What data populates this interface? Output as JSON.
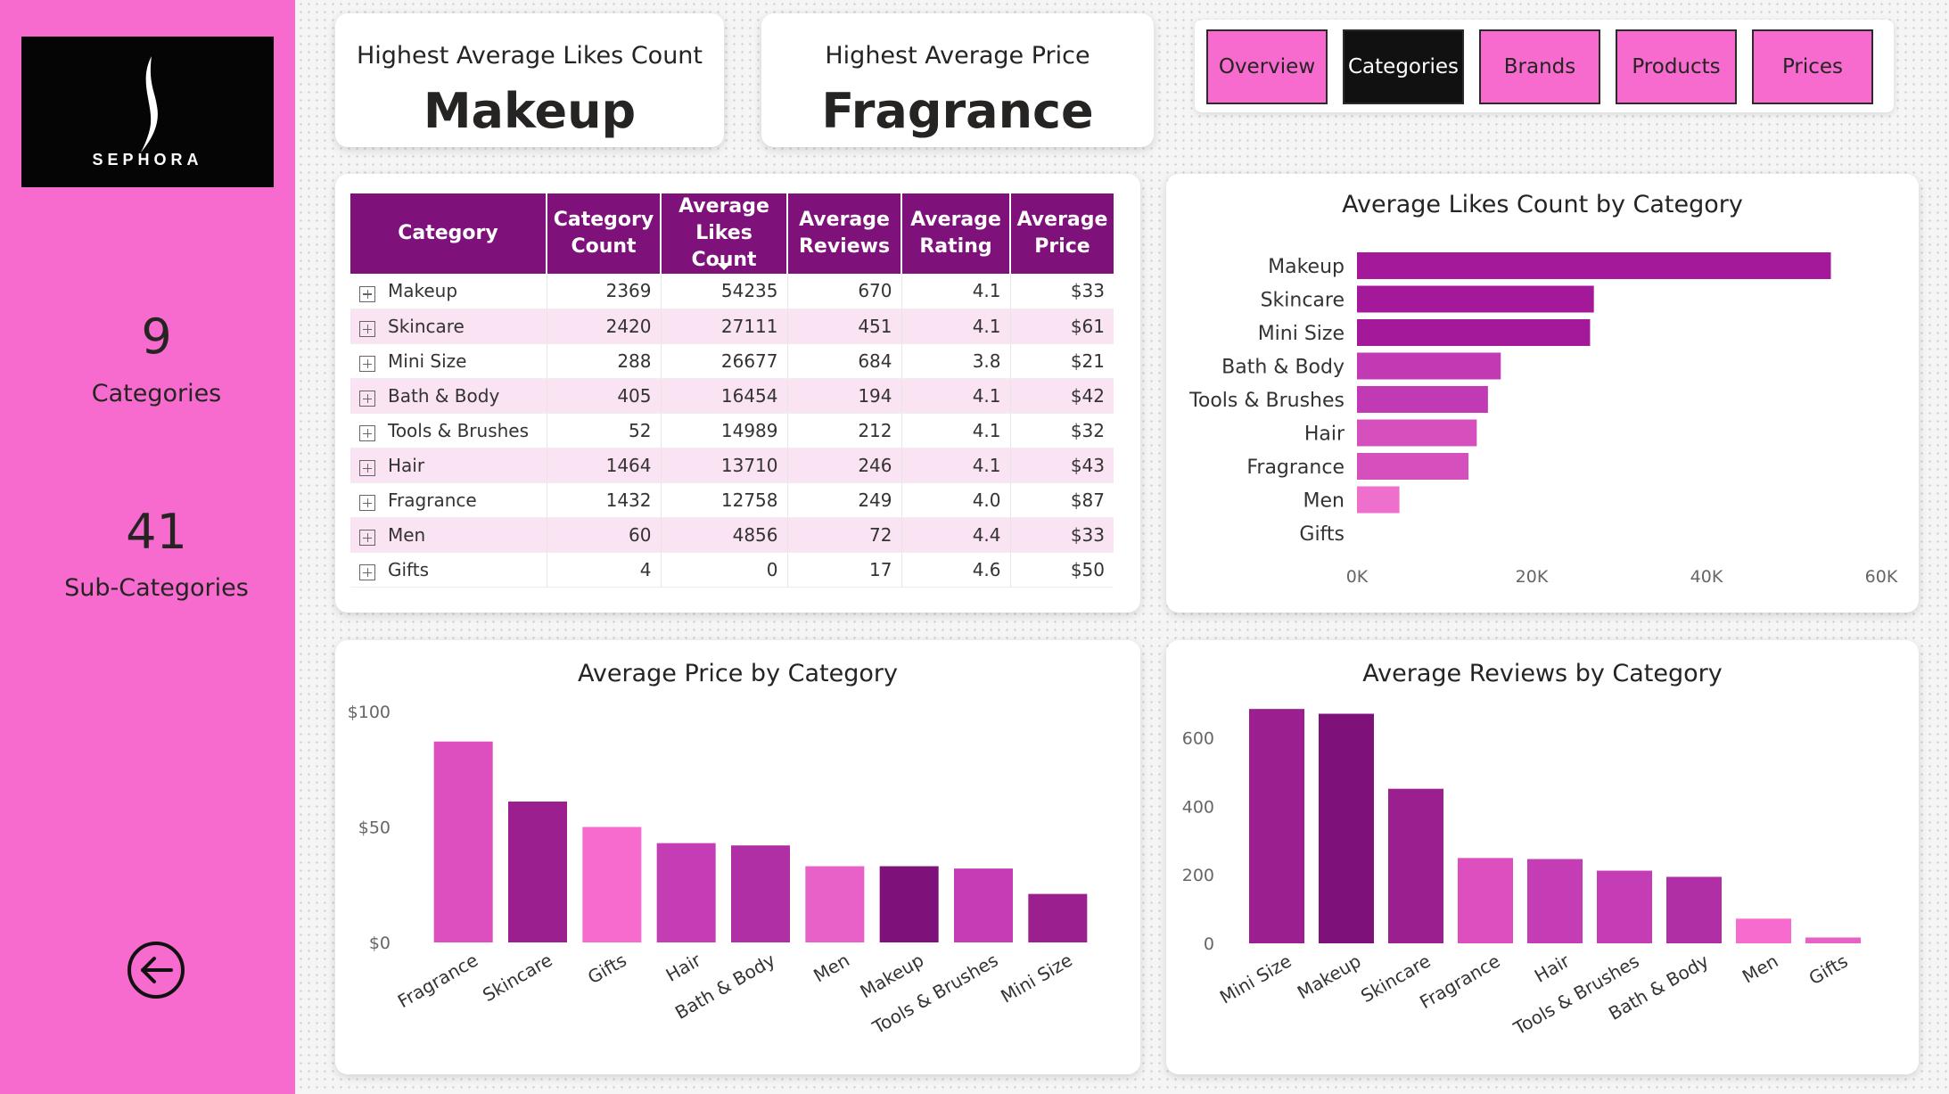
{
  "sidebar": {
    "logo_text": "SEPHORA",
    "categories_count": "9",
    "categories_label": "Categories",
    "subcategories_count": "41",
    "subcategories_label": "Sub-Categories",
    "back_icon": "arrow-left-circle-icon"
  },
  "cards": {
    "likes": {
      "label": "Highest Average Likes Count",
      "value": "Makeup"
    },
    "price": {
      "label": "Highest Average Price",
      "value": "Fragrance"
    }
  },
  "nav": {
    "items": [
      "Overview",
      "Categories",
      "Brands",
      "Products",
      "Prices"
    ],
    "active": "Categories"
  },
  "table": {
    "headers": [
      "Category",
      "Category\nCount",
      "Average\nLikes Count",
      "Average\nReviews",
      "Average\nRating",
      "Average\nPrice"
    ],
    "sorted_column": "Average Likes Count",
    "rows": [
      [
        "Makeup",
        "2369",
        "54235",
        "670",
        "4.1",
        "$33"
      ],
      [
        "Skincare",
        "2420",
        "27111",
        "451",
        "4.1",
        "$61"
      ],
      [
        "Mini Size",
        "288",
        "26677",
        "684",
        "3.8",
        "$21"
      ],
      [
        "Bath & Body",
        "405",
        "16454",
        "194",
        "4.1",
        "$42"
      ],
      [
        "Tools & Brushes",
        "52",
        "14989",
        "212",
        "4.1",
        "$32"
      ],
      [
        "Hair",
        "1464",
        "13710",
        "246",
        "4.1",
        "$43"
      ],
      [
        "Fragrance",
        "1432",
        "12758",
        "249",
        "4.0",
        "$87"
      ],
      [
        "Men",
        "60",
        "4856",
        "72",
        "4.4",
        "$33"
      ],
      [
        "Gifts",
        "4",
        "0",
        "17",
        "4.6",
        "$50"
      ]
    ]
  },
  "colors": {
    "sidebar_bg": "#f76bcf",
    "table_header": "#7e117a",
    "row_alt": "#fae3f3",
    "series": [
      "#7e117a",
      "#9b1f8e",
      "#b02fa5",
      "#c43db5",
      "#dd4fbe",
      "#f070cc"
    ]
  },
  "chart_data": [
    {
      "type": "bar",
      "orientation": "horizontal",
      "title": "Average Likes Count by Category",
      "categories": [
        "Makeup",
        "Skincare",
        "Mini Size",
        "Bath & Body",
        "Tools & Brushes",
        "Hair",
        "Fragrance",
        "Men",
        "Gifts"
      ],
      "values": [
        54235,
        27111,
        26677,
        16454,
        14989,
        13710,
        12758,
        4856,
        0
      ],
      "colors": [
        "#a4189a",
        "#a4189a",
        "#a4189a",
        "#c13ab4",
        "#c13ab4",
        "#d550bd",
        "#d550bd",
        "#ee6fcc",
        "#ee6fcc"
      ],
      "xlim": [
        0,
        60000
      ],
      "xticks": [
        "0K",
        "20K",
        "40K",
        "60K"
      ],
      "grid": false
    },
    {
      "type": "bar",
      "title": "Average Price by Category",
      "categories": [
        "Fragrance",
        "Skincare",
        "Gifts",
        "Hair",
        "Bath & Body",
        "Men",
        "Makeup",
        "Tools & Brushes",
        "Mini Size"
      ],
      "values": [
        87,
        61,
        50,
        43,
        42,
        33,
        33,
        32,
        21
      ],
      "colors": [
        "#dd4fbe",
        "#9b1f8e",
        "#f76bcf",
        "#c43db5",
        "#b02fa5",
        "#e861c8",
        "#7e117a",
        "#c43db5",
        "#9b1f8e"
      ],
      "ylim": [
        0,
        100
      ],
      "yticks": [
        "$0",
        "$50",
        "$100"
      ],
      "grid": false
    },
    {
      "type": "bar",
      "title": "Average Reviews by Category",
      "categories": [
        "Mini Size",
        "Makeup",
        "Skincare",
        "Fragrance",
        "Hair",
        "Tools & Brushes",
        "Bath & Body",
        "Men",
        "Gifts"
      ],
      "values": [
        684,
        670,
        451,
        249,
        246,
        212,
        194,
        72,
        17
      ],
      "colors": [
        "#9b1f8e",
        "#7e117a",
        "#9b1f8e",
        "#dd4fbe",
        "#c43db5",
        "#c43db5",
        "#b02fa5",
        "#f76bcf",
        "#e861c8"
      ],
      "ylim": [
        0,
        700
      ],
      "yticks": [
        "0",
        "200",
        "400",
        "600"
      ],
      "grid": false
    }
  ]
}
